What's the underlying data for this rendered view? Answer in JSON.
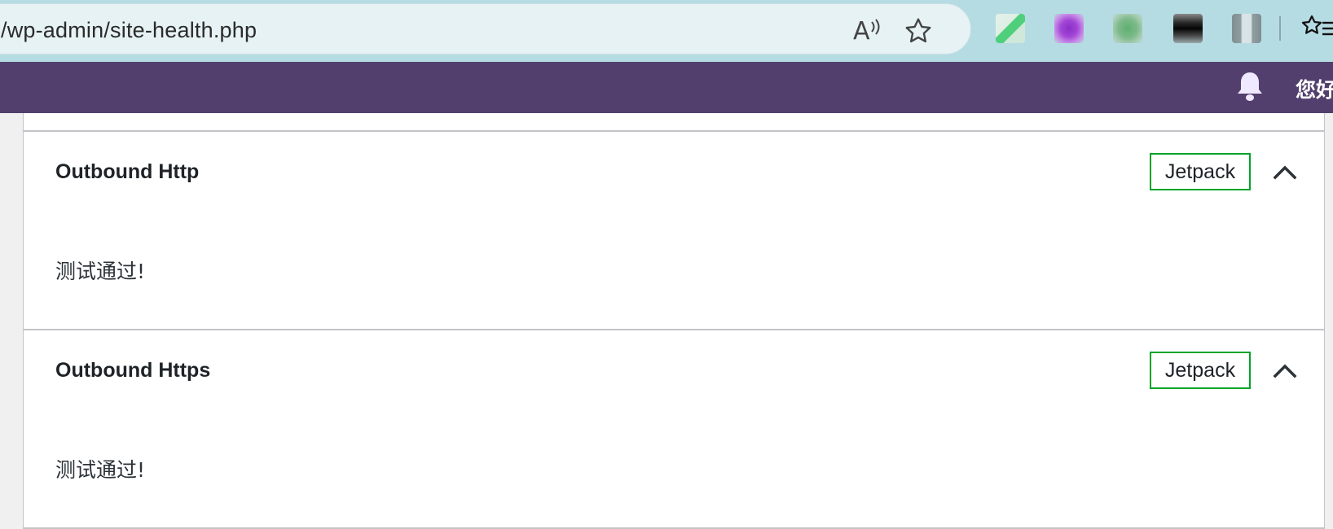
{
  "browser": {
    "url": "/wp-admin/site-health.php",
    "read_aloud_icon": "read-aloud-icon",
    "read_aloud_glyph": "A",
    "favorite_icon": "star-icon",
    "extensions": [
      "extension-1",
      "extension-2",
      "extension-3",
      "extension-4",
      "extension-5"
    ],
    "favorites_icon": "favorites-list-icon"
  },
  "admin_bar": {
    "notifications_icon": "bell-icon",
    "greeting": "您好"
  },
  "colors": {
    "admin_bar_bg": "#523f6d",
    "browser_bar_bg": "#b5dce2",
    "badge_border": "#00a32a"
  },
  "panels": [
    {
      "title": "Outbound Http",
      "badge": "Jetpack",
      "result": "测试通过!",
      "toggle_icon": "chevron-up-icon"
    },
    {
      "title": "Outbound Https",
      "badge": "Jetpack",
      "result": "测试通过!",
      "toggle_icon": "chevron-up-icon"
    }
  ]
}
